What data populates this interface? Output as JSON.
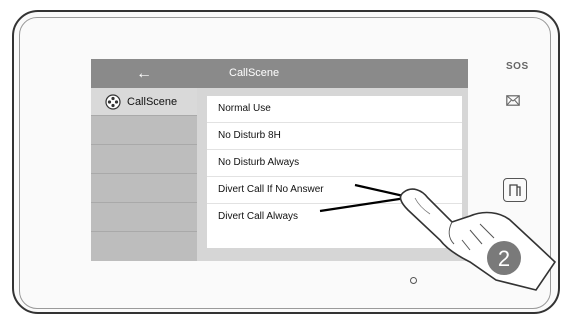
{
  "titlebar": {
    "back_icon": "←",
    "title": "CallScene"
  },
  "sidebar": {
    "items": [
      {
        "label": "CallScene",
        "icon": "callscene-icon",
        "selected": true
      }
    ]
  },
  "options": [
    {
      "label": "Normal Use"
    },
    {
      "label": "No Disturb 8H"
    },
    {
      "label": "No Disturb Always"
    },
    {
      "label": "Divert Call If No Answer"
    },
    {
      "label": "Divert Call Always"
    }
  ],
  "device": {
    "sos_label": "SOS",
    "mail_icon": "envelope-icon",
    "door_icon": "door-icon"
  },
  "step_badge": "2",
  "colors": {
    "titlebar": "#8a8a8a",
    "sidebar": "#bdbdbd",
    "screen_bg": "#d6d6d6",
    "panel": "#ffffff",
    "badge": "#7a7a7a"
  }
}
